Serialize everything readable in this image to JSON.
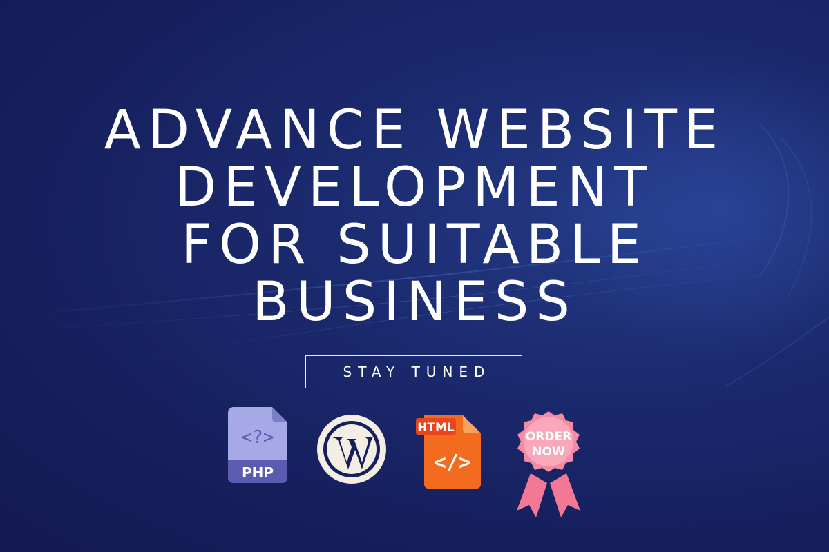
{
  "headline": {
    "line1": "ADVANCE WEBSITE",
    "line2": "DEVELOPMENT",
    "line3": "FOR SUITABLE",
    "line4": "BUSINESS"
  },
  "tagline": "STAY TUNED",
  "icons": {
    "php": {
      "symbol": "<?>",
      "label": "PHP"
    },
    "wordpress": {
      "name": "wordpress-icon"
    },
    "html": {
      "badge": "HTML",
      "symbol": "</>"
    },
    "order": {
      "line1": "ORDER",
      "line2": "NOW"
    }
  },
  "colors": {
    "background": "#161f5c",
    "text": "#ffffff",
    "php_light": "#a7a9e6",
    "php_dark": "#5b5cb0",
    "html_orange": "#f26b1f",
    "html_red": "#e8461e",
    "badge_pink": "#f48aa4",
    "ribbon_pink": "#f37896"
  }
}
